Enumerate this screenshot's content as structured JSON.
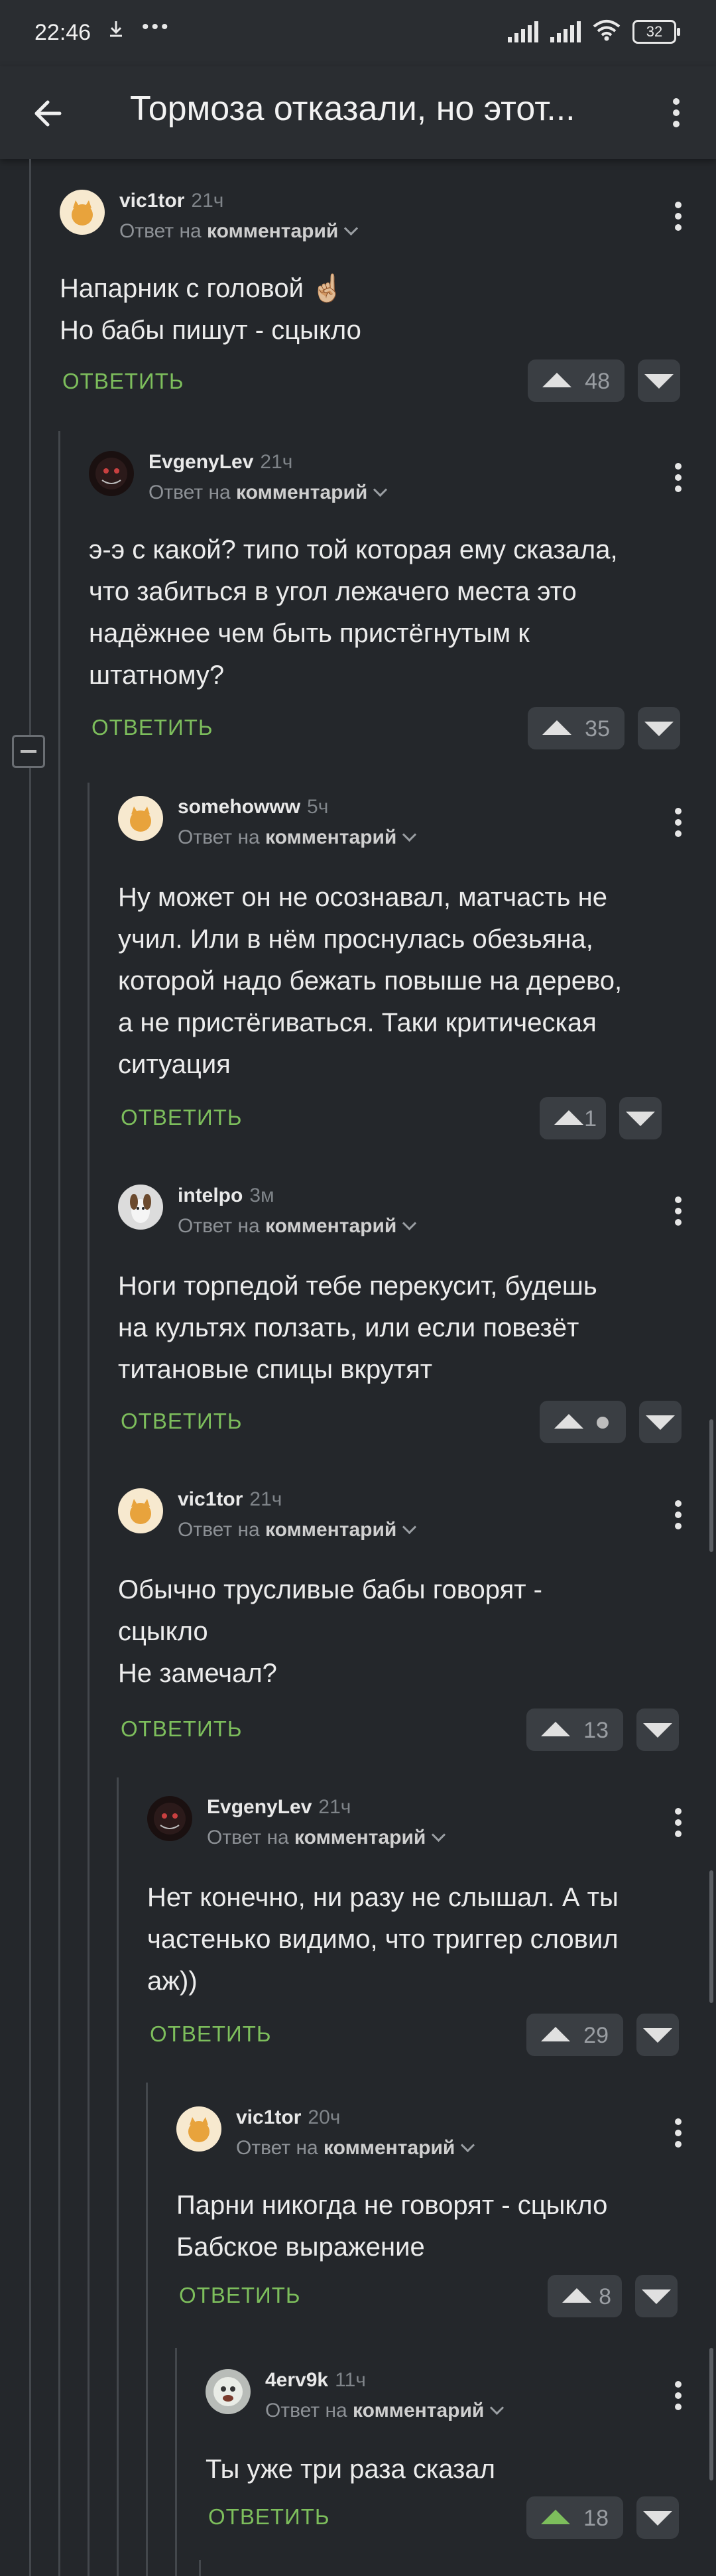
{
  "statusbar": {
    "time": "22:46",
    "battery": "32"
  },
  "header": {
    "title": "Тормоза отказали, но этот..."
  },
  "reply_prefix": "Ответ на",
  "reply_target": "комментарий",
  "reply_label": "ОТВЕТИТЬ",
  "comments": [
    {
      "author": "vic1tor",
      "time": "21ч",
      "text": "Напарник с головой ☝🏼\nНо бабы пишут - сцыкло",
      "votes": "48"
    },
    {
      "author": "EvgenyLev",
      "time": "21ч",
      "text": "э-э с какой? типо той которая ему сказала,\nчто забиться в угол лежачего места это\nнадёжнее чем быть пристёгнутым к\nштатному?",
      "votes": "35"
    },
    {
      "author": "somehowww",
      "time": "5ч",
      "text": "Ну может он не осознавал, матчасть не\nучил. Или в нём проснулась обезьяна,\nкоторой надо бежать повыше на дерево,\nа не пристёгиваться. Таки критическая\nситуация",
      "votes": "1"
    },
    {
      "author": "intelpo",
      "time": "3м",
      "text": "Ноги торпедой тебе перекусит, будешь\nна культях ползать, или если повезёт\nтитановые спицы вкрутят",
      "votes": ""
    },
    {
      "author": "vic1tor",
      "time": "21ч",
      "text": "Обычно трусливые бабы говорят -\nсцыкло\nНе замечал?",
      "votes": "13"
    },
    {
      "author": "EvgenyLev",
      "time": "21ч",
      "text": "Нет конечно, ни разу не слышал. А ты\nчастенько видимо, что триггер словил\nаж))",
      "votes": "29"
    },
    {
      "author": "vic1tor",
      "time": "20ч",
      "text": "Парни никогда не говорят - сцыкло\nБабское выражение",
      "votes": "8"
    },
    {
      "author": "4erv9k",
      "time": "11ч",
      "text": "Ты уже три раза сказал",
      "votes": "18"
    }
  ],
  "icons": {
    "back": "arrow-left-icon",
    "menu": "more-vertical-icon",
    "up": "upvote-icon",
    "down": "downvote-icon",
    "collapse": "collapse-minus-icon"
  },
  "colors": {
    "background": "#24272b",
    "accent_green": "#7dbe5c",
    "vote_bg": "#3a3e43"
  }
}
